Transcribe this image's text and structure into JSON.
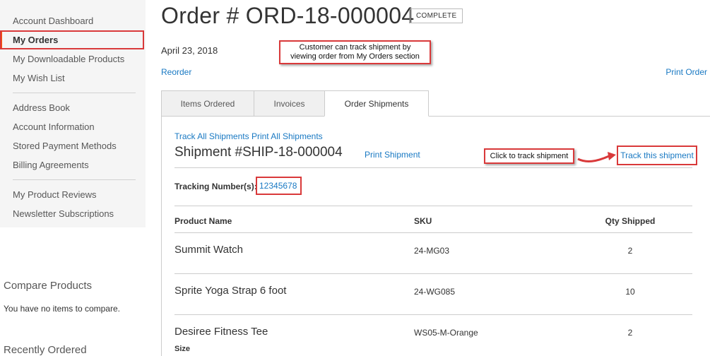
{
  "sidebar": {
    "items": [
      {
        "label": "Account Dashboard"
      },
      {
        "label": "My Orders"
      },
      {
        "label": "My Downloadable Products"
      },
      {
        "label": "My Wish List"
      },
      {
        "label": "Address Book"
      },
      {
        "label": "Account Information"
      },
      {
        "label": "Stored Payment Methods"
      },
      {
        "label": "Billing Agreements"
      },
      {
        "label": "My Product Reviews"
      },
      {
        "label": "Newsletter Subscriptions"
      }
    ]
  },
  "compare": {
    "title": "Compare Products",
    "text": "You have no items to compare."
  },
  "recent": {
    "title": "Recently Ordered"
  },
  "order": {
    "title": "Order # ORD-18-000004",
    "status": "COMPLETE",
    "date": "April 23, 2018",
    "reorder": "Reorder",
    "print_order": "Print Order"
  },
  "callouts": {
    "top_line1": "Customer can track shipment by",
    "top_line2": "viewing order from My Orders section",
    "track": "Click to track shipment"
  },
  "tabs": [
    {
      "label": "Items Ordered"
    },
    {
      "label": "Invoices"
    },
    {
      "label": "Order Shipments"
    }
  ],
  "shipment": {
    "track_all": "Track All Shipments",
    "print_all": "Print All Shipments",
    "title": "Shipment #SHIP-18-000004",
    "print_shipment": "Print Shipment",
    "track_this": "Track this shipment",
    "tracking_label": "Tracking Number(s):",
    "tracking_number": "12345678"
  },
  "table": {
    "headers": {
      "name": "Product Name",
      "sku": "SKU",
      "qty": "Qty Shipped"
    },
    "rows": [
      {
        "name": "Summit Watch",
        "sku": "24-MG03",
        "qty": "2"
      },
      {
        "name": "Sprite Yoga Strap 6 foot",
        "sku": "24-WG085",
        "qty": "10"
      },
      {
        "name": "Desiree Fitness Tee",
        "sku": "WS05-M-Orange",
        "qty": "2"
      }
    ],
    "size_label": "Size"
  },
  "colors": {
    "link": "#1979c3",
    "highlight": "#d9393a",
    "sidebar_bg": "#f5f5f5"
  }
}
